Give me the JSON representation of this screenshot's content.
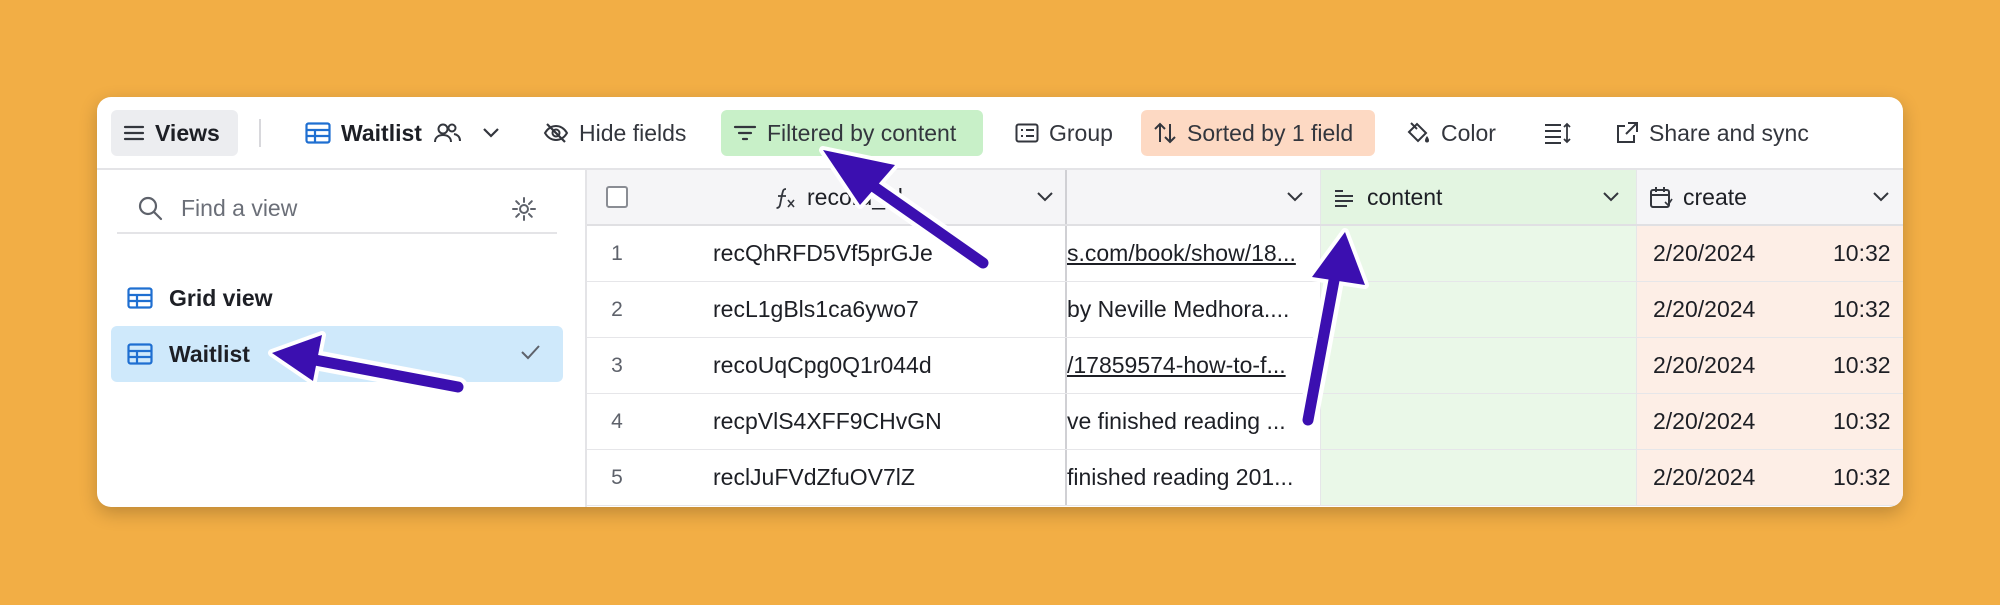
{
  "toolbar": {
    "views_label": "Views",
    "table_name": "Waitlist",
    "hide_fields_label": "Hide fields",
    "filter_label": "Filtered by content",
    "group_label": "Group",
    "sort_label": "Sorted by 1 field",
    "color_label": "Color",
    "share_label": "Share and sync"
  },
  "sidebar": {
    "search_placeholder": "Find a view",
    "views": [
      {
        "label": "Grid view",
        "icon": "grid-icon",
        "selected": false
      },
      {
        "label": "Waitlist",
        "icon": "grid-icon",
        "selected": true
      }
    ]
  },
  "grid": {
    "columns": [
      {
        "label": "record_id",
        "icon": "formula-icon"
      },
      {
        "label": "",
        "icon": ""
      },
      {
        "label": "content",
        "icon": "long-text-icon"
      },
      {
        "label": "create",
        "icon": "calendar-icon"
      }
    ],
    "rows": [
      {
        "num": "1",
        "record_id": "recQhRFD5Vf5prGJe",
        "source": "s.com/book/show/18...",
        "content": "",
        "date": "2/20/2024",
        "time": "10:32"
      },
      {
        "num": "2",
        "record_id": "recL1gBls1ca6ywo7",
        "source": "by Neville Medhora....",
        "content": "",
        "date": "2/20/2024",
        "time": "10:32"
      },
      {
        "num": "3",
        "record_id": "recoUqCpg0Q1r044d",
        "source": "/17859574-how-to-f...",
        "content": "",
        "date": "2/20/2024",
        "time": "10:32"
      },
      {
        "num": "4",
        "record_id": "recpVlS4XFF9CHvGN",
        "source": "ve finished reading ...",
        "content": "",
        "date": "2/20/2024",
        "time": "10:32"
      },
      {
        "num": "5",
        "record_id": "reclJuFVdZfuOV7lZ",
        "source": "finished reading 201...",
        "content": "",
        "date": "2/20/2024",
        "time": "10:32"
      }
    ]
  },
  "colors": {
    "background": "#f2ae45",
    "filter_highlight": "#c8f0c8",
    "sort_highlight": "#fdd9c3",
    "selected_view": "#cfe9fb",
    "annotation_arrow": "#3b0fb0"
  }
}
